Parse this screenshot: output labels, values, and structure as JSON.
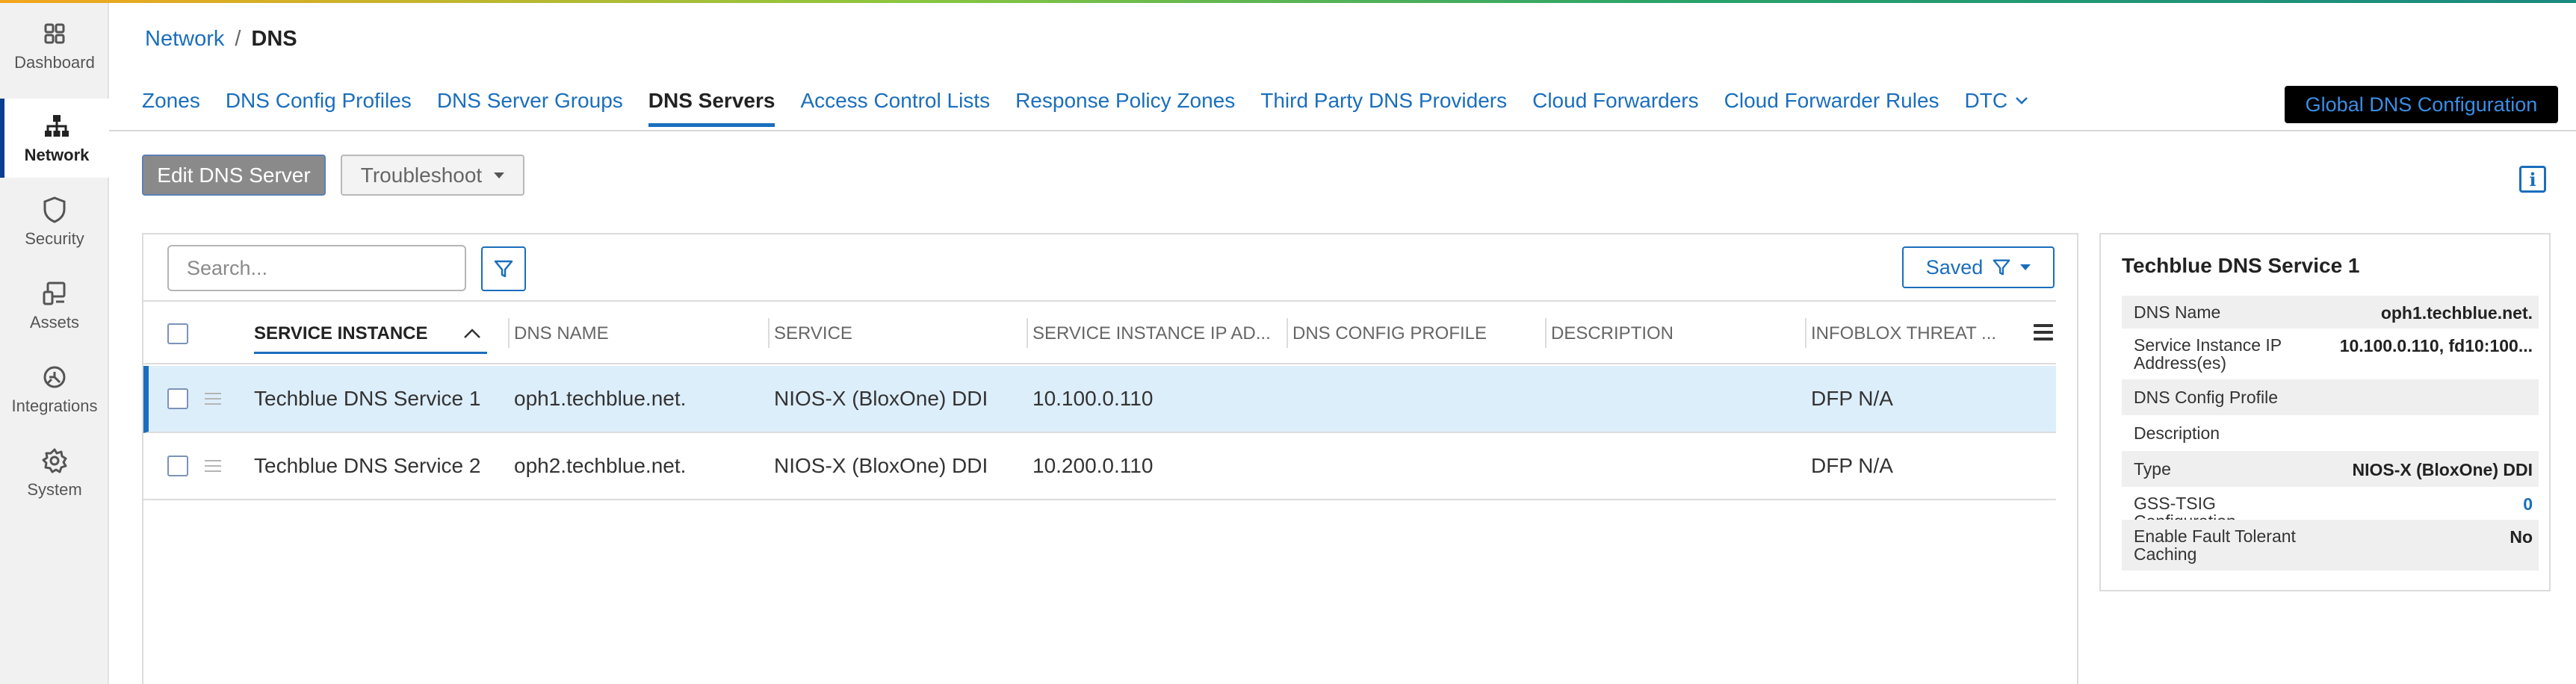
{
  "colors": {
    "accent": "#1a6ebd",
    "selected_row": "#ddeefb",
    "primary_disabled": "#8a8a8a",
    "global_btn_bg": "#000000"
  },
  "sidebar": {
    "items": [
      {
        "label": "Dashboard",
        "icon": "dashboard-grid-icon",
        "active": false
      },
      {
        "label": "Network",
        "icon": "network-icon",
        "active": true
      },
      {
        "label": "Security",
        "icon": "shield-icon",
        "active": false
      },
      {
        "label": "Assets",
        "icon": "devices-icon",
        "active": false
      },
      {
        "label": "Integrations",
        "icon": "integrations-icon",
        "active": false
      },
      {
        "label": "System",
        "icon": "gear-icon",
        "active": false
      }
    ]
  },
  "breadcrumb": {
    "parent": "Network",
    "separator": "/",
    "current": "DNS"
  },
  "tabs": [
    "Zones",
    "DNS Config Profiles",
    "DNS Server Groups",
    "DNS Servers",
    "Access Control Lists",
    "Response Policy Zones",
    "Third Party DNS Providers",
    "Cloud Forwarders",
    "Cloud Forwarder Rules",
    "DTC"
  ],
  "active_tab": "DNS Servers",
  "global_button": "Global DNS Configuration",
  "toolbar": {
    "edit_label": "Edit DNS Server",
    "troubleshoot_label": "Troubleshoot",
    "info_icon": "info-icon"
  },
  "grid": {
    "search_placeholder": "Search...",
    "saved_label": "Saved",
    "columns": [
      "SERVICE INSTANCE",
      "DNS NAME",
      "SERVICE",
      "SERVICE INSTANCE IP AD...",
      "DNS CONFIG PROFILE",
      "DESCRIPTION",
      "INFOBLOX THREAT ..."
    ],
    "rows": [
      {
        "service_instance": "Techblue DNS Service 1",
        "dns_name": "oph1.techblue.net.",
        "service": "NIOS-X (BloxOne) DDI",
        "ip": "10.100.0.110",
        "config_profile": "",
        "description": "",
        "threat": "DFP N/A",
        "selected": true
      },
      {
        "service_instance": "Techblue DNS Service 2",
        "dns_name": "oph2.techblue.net.",
        "service": "NIOS-X (BloxOne) DDI",
        "ip": "10.200.0.110",
        "config_profile": "",
        "description": "",
        "threat": "DFP N/A",
        "selected": false
      }
    ]
  },
  "detail": {
    "title": "Techblue DNS Service 1",
    "fields": [
      {
        "key": "DNS Name",
        "value": "oph1.techblue.net."
      },
      {
        "key": "Service Instance IP Address(es)",
        "value": "10.100.0.110, fd10:100..."
      },
      {
        "key": "DNS Config Profile",
        "value": ""
      },
      {
        "key": "Description",
        "value": ""
      },
      {
        "key": "Type",
        "value": "NIOS-X (BloxOne) DDI"
      },
      {
        "key": "GSS-TSIG Configuration",
        "value": "0"
      },
      {
        "key": "Enable Fault Tolerant Caching",
        "value": "No"
      }
    ]
  }
}
